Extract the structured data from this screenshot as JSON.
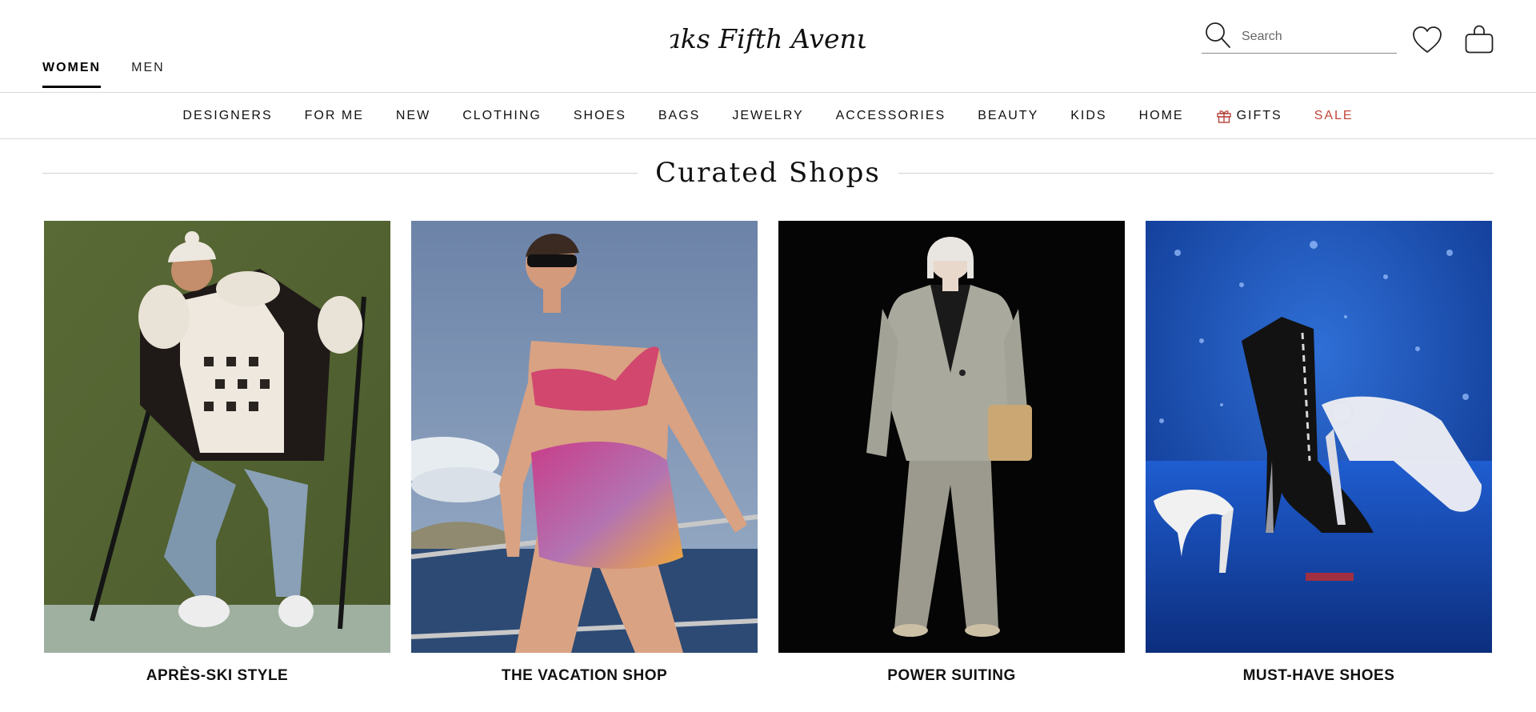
{
  "header": {
    "logo_text": "Saks Fifth Avenue",
    "gender_tabs": [
      {
        "label": "WOMEN",
        "active": true
      },
      {
        "label": "MEN",
        "active": false
      }
    ],
    "search": {
      "placeholder": "Search",
      "value": ""
    },
    "icons": [
      "search-icon",
      "heart-icon",
      "shopping-bag-icon"
    ]
  },
  "category_nav": {
    "items": [
      {
        "label": "DESIGNERS"
      },
      {
        "label": "FOR ME"
      },
      {
        "label": "NEW"
      },
      {
        "label": "CLOTHING"
      },
      {
        "label": "SHOES"
      },
      {
        "label": "BAGS"
      },
      {
        "label": "JEWELRY"
      },
      {
        "label": "ACCESSORIES"
      },
      {
        "label": "BEAUTY"
      },
      {
        "label": "KIDS"
      },
      {
        "label": "HOME"
      },
      {
        "label": "GIFTS",
        "icon": "gift-icon"
      },
      {
        "label": "SALE"
      }
    ],
    "sale_color": "#c2463a"
  },
  "curated": {
    "title": "Curated Shops",
    "tiles": [
      {
        "label": "APRÈS-SKI STYLE",
        "image": "woman in white beanie and shearling jacket holding ski poles"
      },
      {
        "label": "THE VACATION SHOP",
        "image": "woman in pink bikini and sarong on a boat"
      },
      {
        "label": "POWER SUITING",
        "image": "woman in grey suit holding tan clutch"
      },
      {
        "label": "MUST-HAVE SHOES",
        "image": "high heels and lace-up boot on blue glitter background"
      }
    ]
  },
  "colors": {
    "text": "#111111",
    "divider": "#d9d9d9",
    "sale": "#c2463a"
  }
}
